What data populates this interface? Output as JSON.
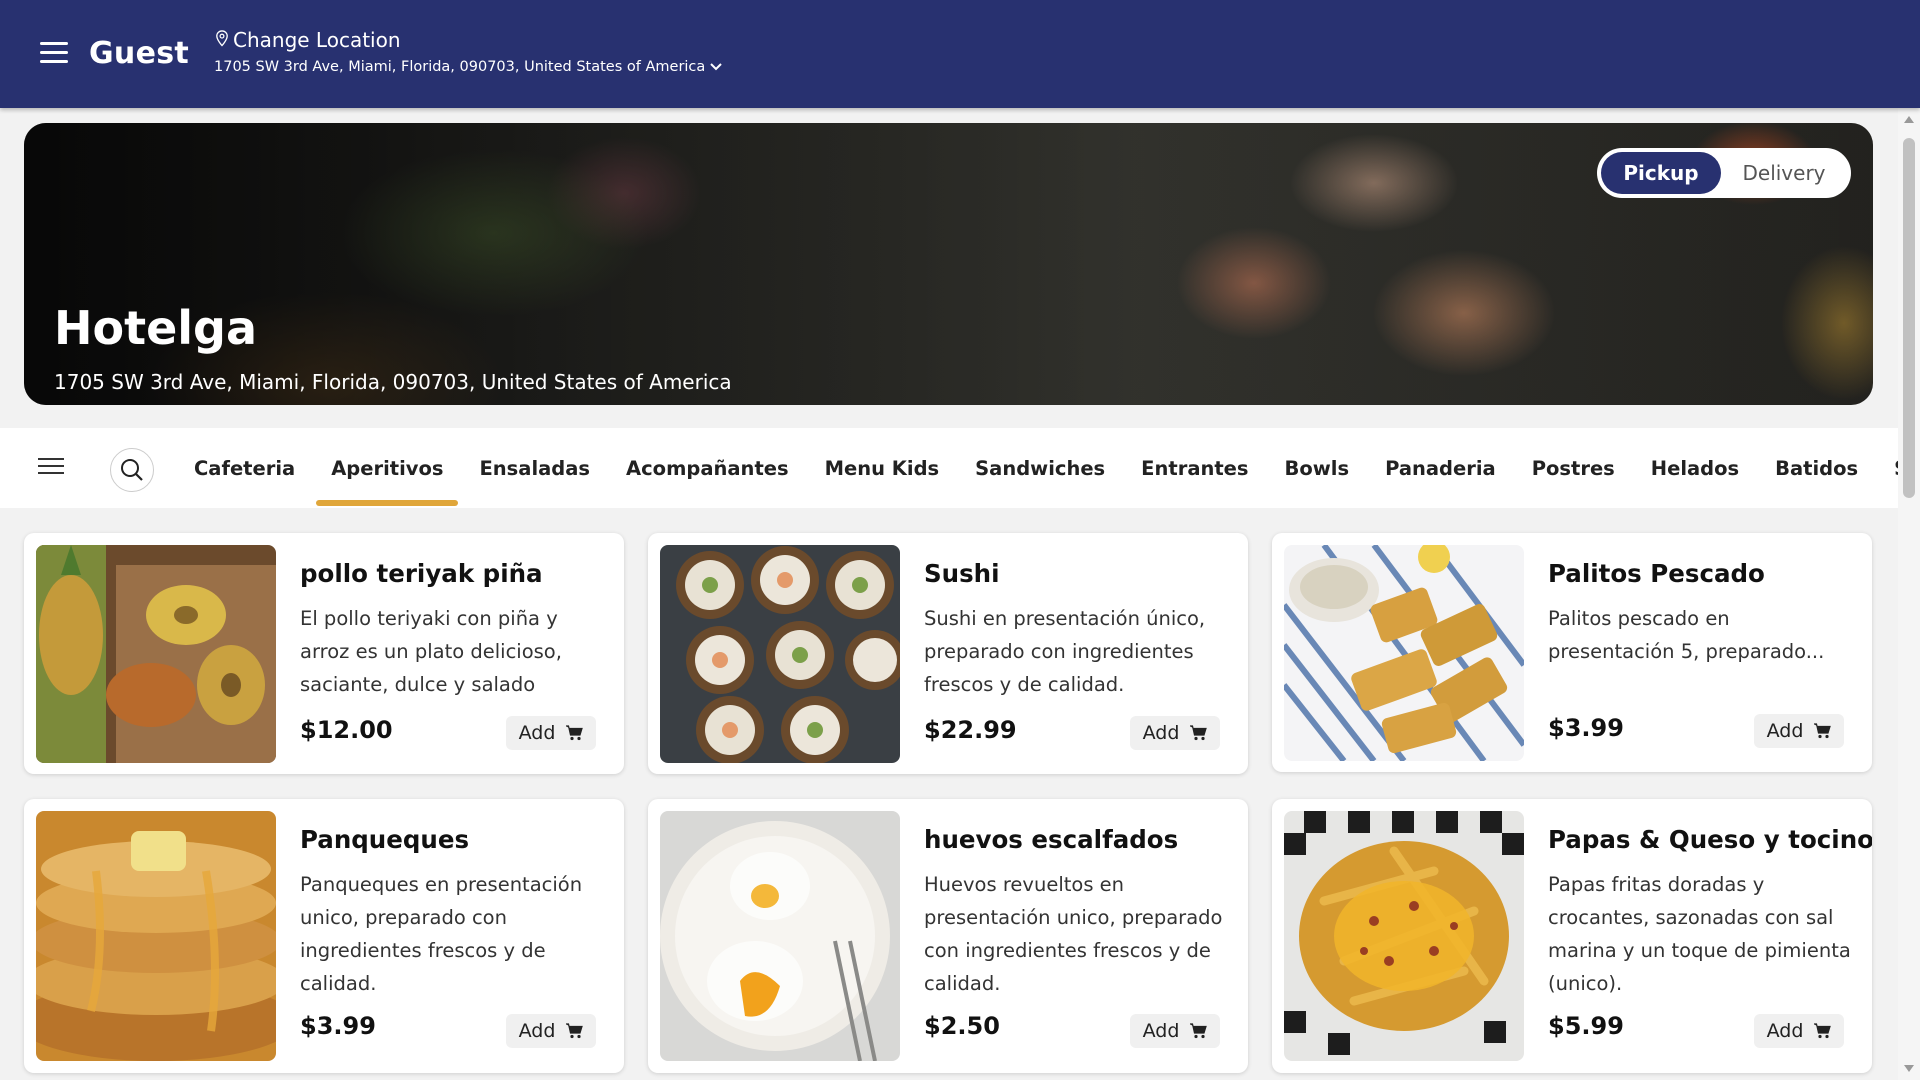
{
  "header": {
    "user": "Guest",
    "change_location": "Change Location",
    "address": "1705 SW 3rd Ave, Miami, Florida, 090703, United States of America"
  },
  "hero": {
    "restaurant": "Hotelga",
    "address": "1705 SW 3rd Ave, Miami, Florida, 090703, United States of America",
    "modes": [
      "Pickup",
      "Delivery"
    ],
    "selected_mode": "Pickup"
  },
  "categories": {
    "items": [
      "Cafeteria",
      "Aperitivos",
      "Ensaladas",
      "Acompañantes",
      "Menu Kids",
      "Sandwiches",
      "Entrantes",
      "Bowls",
      "Panaderia",
      "Postres",
      "Helados",
      "Batidos",
      "Soda"
    ],
    "active": "Aperitivos"
  },
  "products": [
    {
      "title": "pollo teriyak piña",
      "desc": "El pollo teriyaki con piña y arroz es un plato delicioso, saciante, dulce y salado",
      "price": "$12.00",
      "add": "Add"
    },
    {
      "title": "Sushi",
      "desc": "Sushi en presentación único, preparado con ingredientes frescos y de calidad.",
      "price": "$22.99",
      "add": "Add"
    },
    {
      "title": "Palitos Pescado",
      "desc": "Palitos pescado en presentación 5, preparado...",
      "price": "$3.99",
      "add": "Add"
    },
    {
      "title": "Panqueques",
      "desc": "Panqueques en presentación unico, preparado con ingredientes frescos y de calidad.",
      "price": "$3.99",
      "add": "Add"
    },
    {
      "title": "huevos escalfados",
      "desc": "Huevos revueltos en presentación unico, preparado con ingredientes frescos y de calidad.",
      "price": "$2.50",
      "add": "Add"
    },
    {
      "title": "Papas & Queso y tocino",
      "desc": "Papas fritas doradas y crocantes, sazonadas con sal marina y un toque de pimienta (unico).",
      "price": "$5.99",
      "add": "Add"
    }
  ],
  "colors": {
    "primary": "#283170",
    "accent": "#e0a63a"
  }
}
